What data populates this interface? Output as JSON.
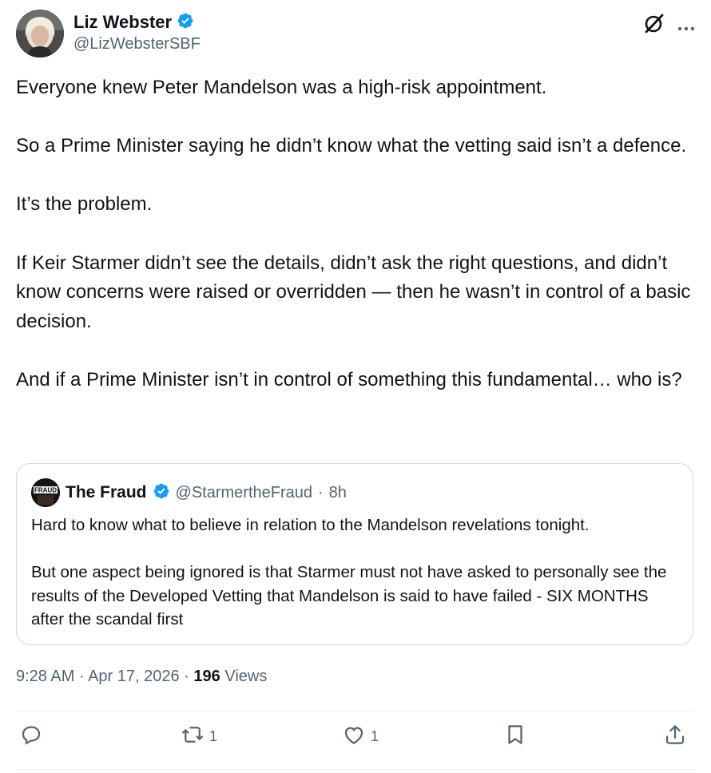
{
  "author": {
    "name": "Liz Webster",
    "handle": "@LizWebsterSBF",
    "verified": true
  },
  "header_icons": [
    "grok-icon",
    "more-icon"
  ],
  "tweet": {
    "paragraphs": [
      "Everyone knew Peter Mandelson was a high-risk appointment.",
      "So a Prime Minister saying he didn’t know what the vetting said isn’t a defence.",
      "It’s the problem.",
      "If Keir Starmer didn’t see the details, didn’t ask the right questions, and didn’t know concerns were raised or overridden — then he wasn’t in control of a basic decision.",
      "And if a Prime Minister isn’t in control of something this fundamental… who is?"
    ]
  },
  "quote": {
    "name": "The Fraud",
    "handle": "@StarmertheFraud",
    "separator": "·",
    "time": "8h",
    "avatar_text": "FRAUD",
    "paragraphs": [
      "Hard to know what to believe in relation to the Mandelson revelations tonight.",
      "But one aspect being ignored is that Starmer must not have asked to personally see the results of the Developed Vetting that Mandelson is said to have failed - SIX MONTHS after the scandal first"
    ]
  },
  "meta": {
    "time": "9:28 AM",
    "sep1": "·",
    "date": "Apr 17, 2026",
    "sep2": "·",
    "views_count": "196",
    "views_label": "Views"
  },
  "actions": {
    "reply_count": "",
    "retweet_count": "1",
    "like_count": "1",
    "bookmark_count": "",
    "share_count": ""
  },
  "colors": {
    "text": "#0f1419",
    "secondary": "#536471",
    "verified": "#1d9bf0",
    "border": "#cfd9de"
  }
}
